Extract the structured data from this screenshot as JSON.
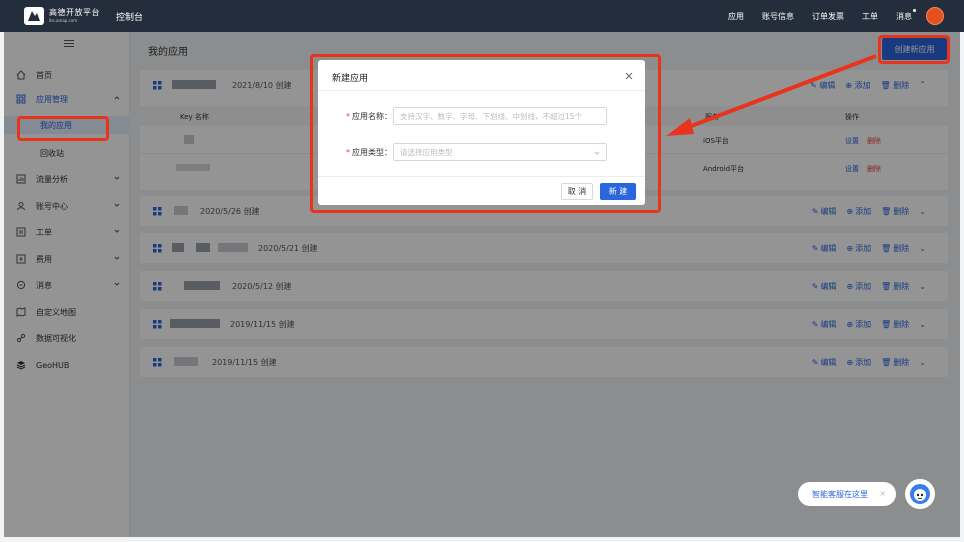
{
  "topbar": {
    "logo_text": "高德开放平台",
    "logo_sub": "lbs.amap.com",
    "console": "控制台",
    "nav": [
      "应用",
      "账号信息",
      "订单发票",
      "工单",
      "消息"
    ]
  },
  "sidebar": {
    "items": [
      {
        "label": "首页",
        "icon": "home-icon"
      },
      {
        "label": "应用管理",
        "icon": "app-grid-icon"
      },
      {
        "label": "我的应用"
      },
      {
        "label": "回收站"
      },
      {
        "label": "流量分析",
        "icon": "chart-icon"
      },
      {
        "label": "账号中心",
        "icon": "user-icon"
      },
      {
        "label": "工单",
        "icon": "ticket-icon"
      },
      {
        "label": "费用",
        "icon": "fee-icon"
      },
      {
        "label": "消息",
        "icon": "message-icon"
      },
      {
        "label": "自定义地图",
        "icon": "custom-map-icon"
      },
      {
        "label": "数据可视化",
        "icon": "visual-icon"
      },
      {
        "label": "GeoHUB",
        "icon": "layers-icon"
      }
    ]
  },
  "main": {
    "title": "我的应用",
    "create_button": "创建新应用",
    "apps": [
      {
        "created": "2021/8/10 创建"
      },
      {
        "created": "2020/5/26 创建"
      },
      {
        "created": "2020/5/21 创建"
      },
      {
        "created": "2020/5/12 创建"
      },
      {
        "created": "2019/11/15 创建"
      },
      {
        "created": "2019/11/15 创建"
      }
    ],
    "actions": {
      "edit": "编辑",
      "add": "添加",
      "delete": "删除"
    },
    "table": {
      "col_key": "Key 名称",
      "col_service": "服务",
      "col_ops": "操作",
      "rows": [
        {
          "platform": "iOS平台",
          "settings": "设置",
          "delete": "删除"
        },
        {
          "platform": "Android平台",
          "settings": "设置",
          "delete": "删除"
        }
      ]
    }
  },
  "dialog": {
    "title": "新建应用",
    "name_label": "应用名称：",
    "name_placeholder": "支持汉字、数字、字母、下划线、中划线，不超过15个",
    "type_label": "应用类型：",
    "type_placeholder": "请选择应用类型",
    "cancel": "取 消",
    "confirm": "新 建"
  },
  "chat": {
    "label": "智能客服在这里",
    "close": "×"
  },
  "colors": {
    "accent": "#2a66dc",
    "annotation": "#e8341c",
    "topbar": "#232d3b"
  }
}
